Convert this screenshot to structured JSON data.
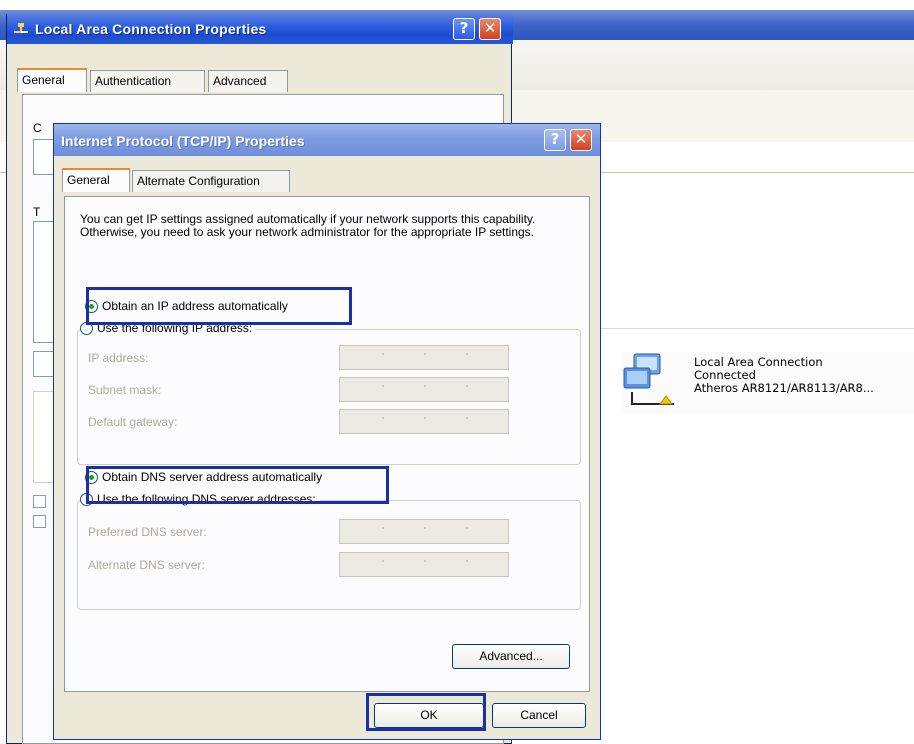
{
  "background_window": {
    "connection": {
      "name": "Local Area Connection",
      "status": "Connected",
      "adapter": "Atheros AR8121/AR8113/AR8..."
    }
  },
  "lan_properties": {
    "title": "Local Area Connection Properties",
    "tabs": [
      "General",
      "Authentication",
      "Advanced"
    ],
    "partial_text": [
      "C",
      "T"
    ]
  },
  "tcpip_dialog": {
    "title": "Internet Protocol (TCP/IP) Properties",
    "tabs": [
      "General",
      "Alternate Configuration"
    ],
    "intro_text": "You can get IP settings assigned automatically if your network supports this capability. Otherwise, you need to ask your network administrator for the appropriate IP settings.",
    "ip": {
      "auto_label": "Obtain an IP address automatically",
      "manual_label": "Use the following IP address:",
      "selected": "auto",
      "fields": [
        {
          "label": "IP address:"
        },
        {
          "label": "Subnet mask:"
        },
        {
          "label": "Default gateway:"
        }
      ]
    },
    "dns": {
      "auto_label": "Obtain DNS server address automatically",
      "manual_label": "Use the following DNS server addresses:",
      "selected": "auto",
      "fields": [
        {
          "label": "Preferred DNS server:"
        },
        {
          "label": "Alternate DNS server:"
        }
      ]
    },
    "buttons": {
      "advanced": "Advanced...",
      "ok": "OK",
      "cancel": "Cancel"
    },
    "help_glyph": "?",
    "close_glyph": "✕"
  },
  "colors": {
    "highlight": "#1b2fa8",
    "title_active": "#2c5fe0",
    "title_inactive": "#7d9be0",
    "dialog_face": "#ece9d8"
  }
}
